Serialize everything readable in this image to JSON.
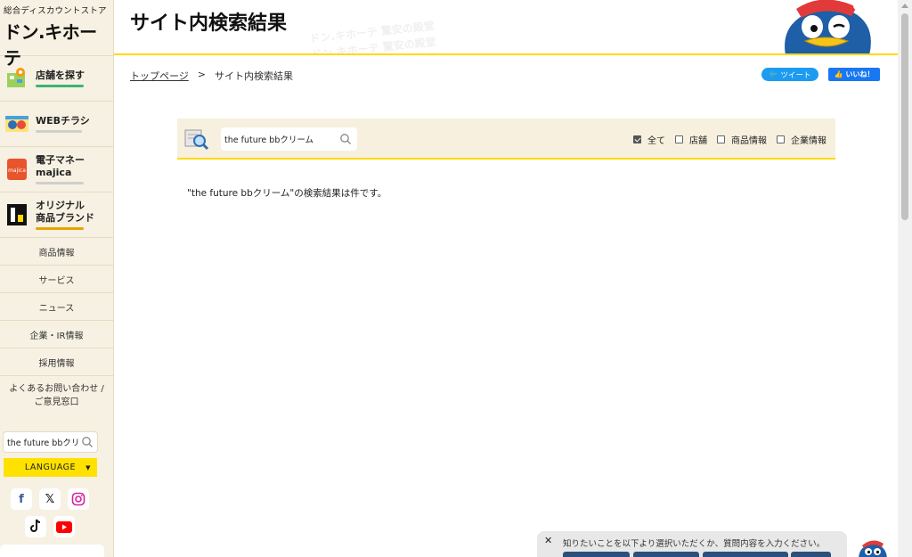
{
  "sidebar": {
    "tagline": "総合ディスカウントストア",
    "brand": "ドン.キホーテ",
    "features": [
      {
        "label": "店舗を探す",
        "icon": "map-pin-icon",
        "underline_color": "#3cb371"
      },
      {
        "label": "WEBチラシ",
        "icon": "flyer-icon",
        "underline_color": "#cfcfcf"
      },
      {
        "label": "電子マネー\nmajica",
        "icon": "majica-card-icon",
        "underline_color": "#cfcfcf"
      },
      {
        "label": "オリジナル\n商品ブランド",
        "icon": "private-brand-icon",
        "underline_color": "#e6a400"
      }
    ],
    "menu": [
      "商品情報",
      "サービス",
      "ニュース",
      "企業・IR情報",
      "採用情報",
      "よくあるお問い合わせ /\nご意見窓口"
    ],
    "search_value": "the future bbクリ",
    "language_label": "LANGUAGE",
    "social": [
      "facebook-icon",
      "x-icon",
      "instagram-icon",
      "tiktok-icon",
      "youtube-icon"
    ]
  },
  "header": {
    "title": "サイト内検索結果",
    "pattern_text": "ドン.キホーテ 驚安の殿堂"
  },
  "breadcrumb": {
    "home": "トップページ",
    "separator": ">",
    "current": "サイト内検索結果"
  },
  "share": {
    "tweet": "ツイート",
    "like": "いいね！"
  },
  "search": {
    "value": "the future bbクリーム",
    "filters": [
      {
        "label": "全て",
        "checked": true
      },
      {
        "label": "店舗",
        "checked": false
      },
      {
        "label": "商品情報",
        "checked": false
      },
      {
        "label": "企業情報",
        "checked": false
      }
    ]
  },
  "result": {
    "message": "\"the future bbクリーム\"の検索結果は件です。"
  },
  "chat": {
    "close": "✕",
    "prompt": "知りたいことを以下より選択いただくか、質問内容を入力ください。"
  },
  "colors": {
    "accent_yellow": "#ffd900",
    "sidebar_bg": "#f7f1e3",
    "twitter": "#1d9bf0",
    "facebook": "#1877f2",
    "chat_button": "#2c4f7c"
  }
}
